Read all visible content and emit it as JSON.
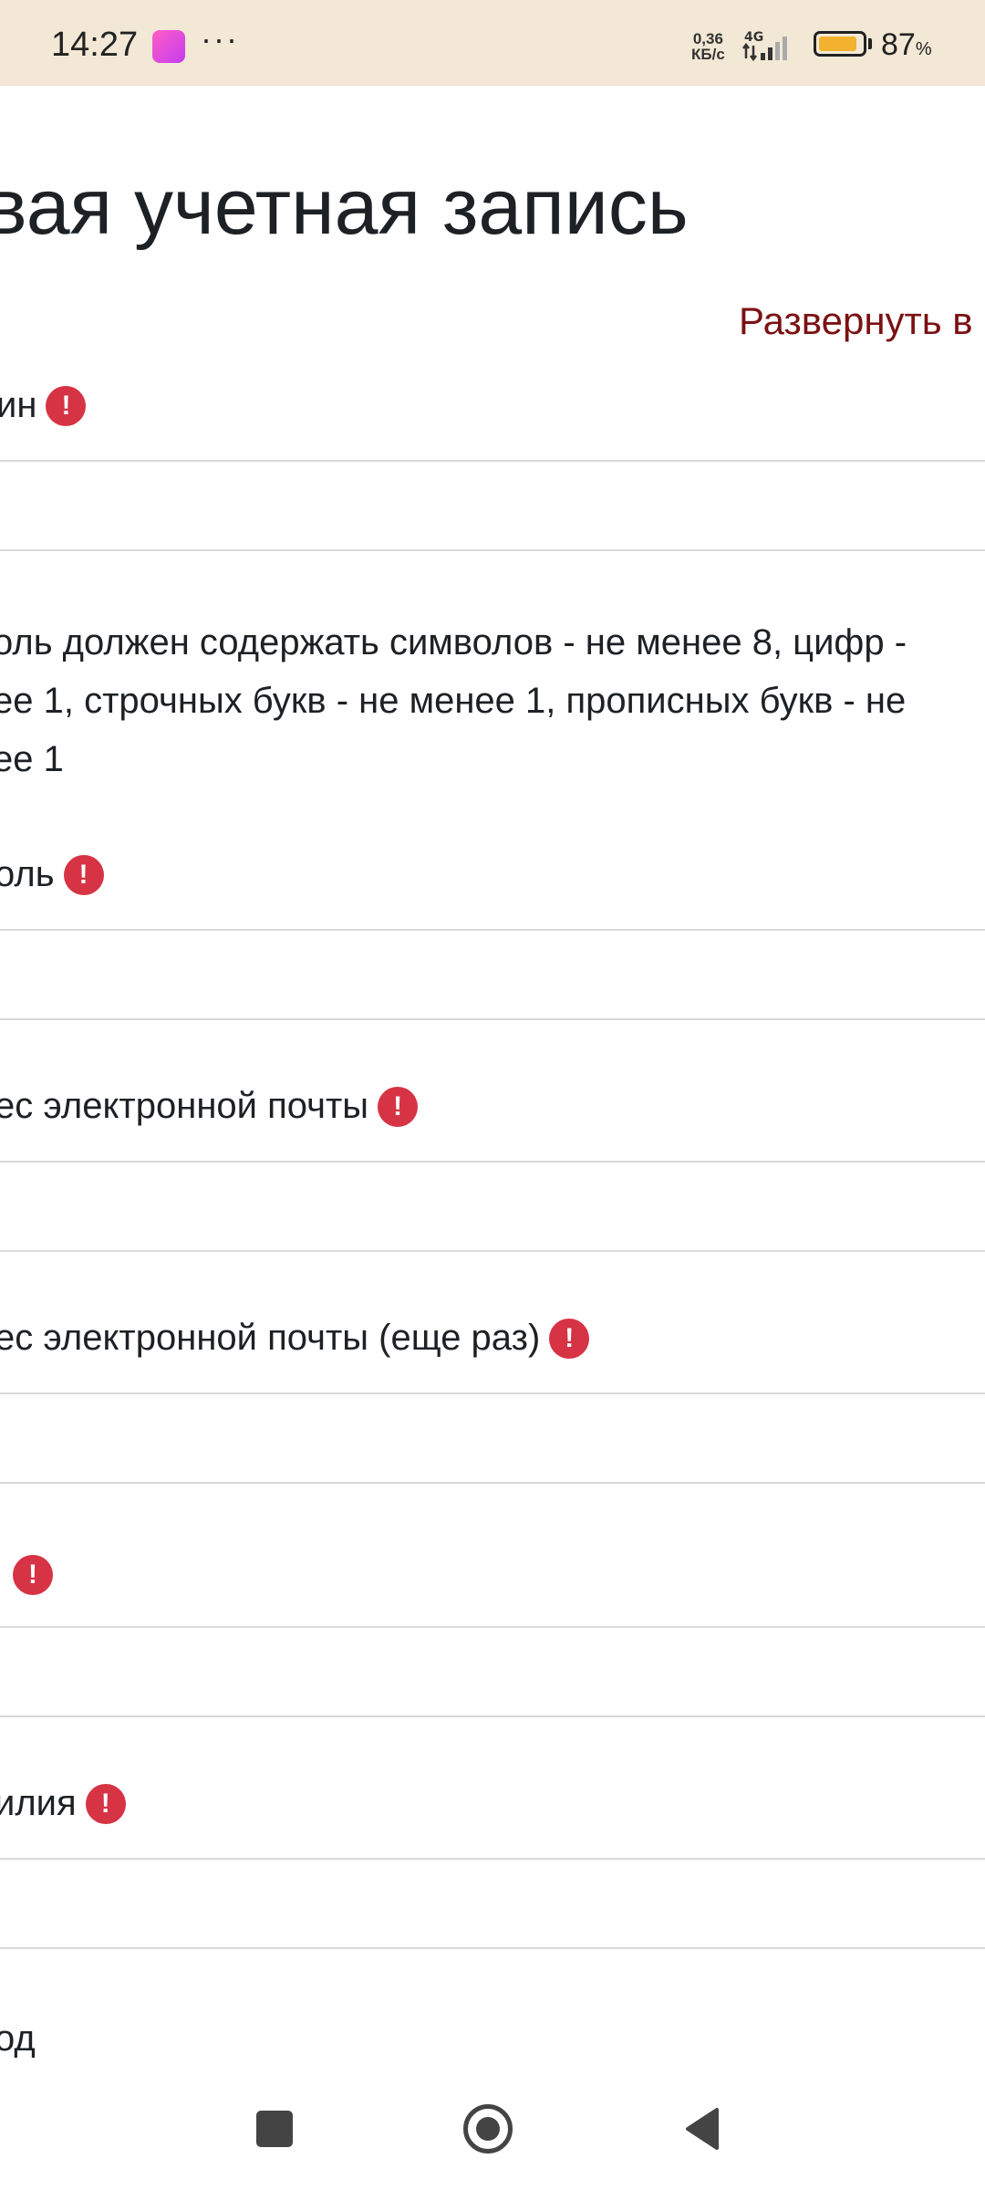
{
  "status_bar": {
    "time": "14:27",
    "more": "···",
    "net_speed_value": "0,36",
    "net_speed_unit": "КБ/с",
    "network": "4G",
    "battery_level": 0.87,
    "battery_percent": "87",
    "battery_percent_sign": "%",
    "app_icon": "app-notification-icon",
    "accent_color": "#f2b230",
    "bar_color": "#f2e8d5"
  },
  "page": {
    "title": "вая учетная запись",
    "expand_link": "Развернуть в"
  },
  "form": {
    "username_label": "ин",
    "password_help": "оль должен содержать символов - не менее 8, цифр - ее 1, строчных букв - не менее 1, прописных букв - не ее 1",
    "password_help_line1": "оль должен содержать символов - не менее 8, цифр -",
    "password_help_line2": "ее 1, строчных букв - не менее 1, прописных букв - не",
    "password_help_line3": "ее 1",
    "password_label": "оль",
    "email_label": "ес электронной почты",
    "email_repeat_label": "ес электронной почты (еще раз)",
    "firstname_label": "",
    "lastname_label": "илия",
    "city_label": "од",
    "required_icon": "!",
    "required_color": "#d63345"
  },
  "nav_bar": {
    "recent_icon": "square-icon",
    "home_icon": "circle-home-icon",
    "back_icon": "triangle-back-icon"
  }
}
